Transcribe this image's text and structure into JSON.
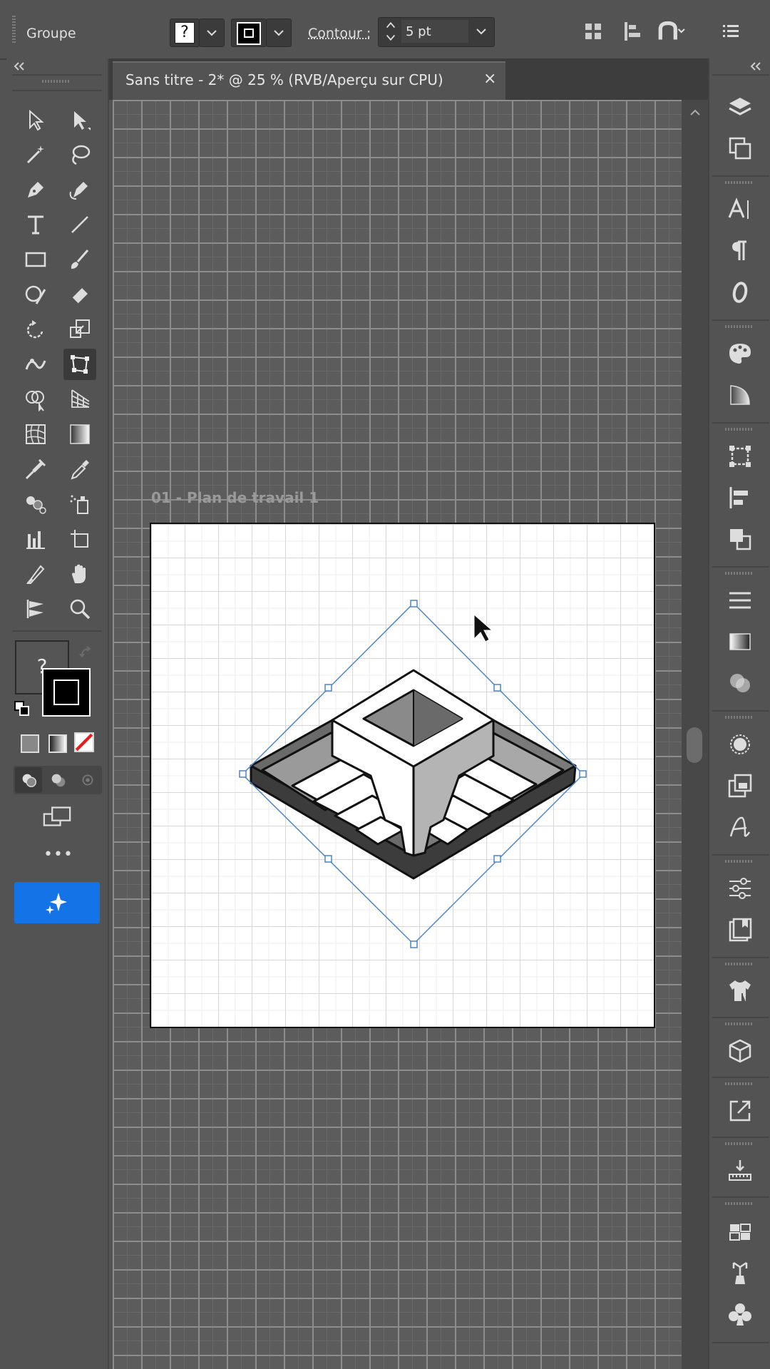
{
  "control_bar": {
    "selection_label": "Groupe",
    "fill_swatch_symbol": "?",
    "stroke_label": "Contour :",
    "stroke_weight": "5 pt",
    "icons": [
      "align-icon",
      "distribute-icon",
      "snap-icon",
      "menu-icon"
    ]
  },
  "document": {
    "tab_title": "Sans titre - 2* @ 25 % (RVB/Aperçu sur CPU)",
    "close_symbol": "×"
  },
  "artboard": {
    "label": "01 - Plan de travail 1"
  },
  "toolbar": {
    "fill_swatch_symbol": "?",
    "more_tools": "•••",
    "colors": {
      "active_button": "#1473e6",
      "selection": "#4a90e2"
    }
  },
  "colors": {
    "ui_background": "#535353",
    "canvas": "#5c5c5c",
    "artboard": "#ffffff",
    "selection_bbox": "#4a86c8"
  }
}
